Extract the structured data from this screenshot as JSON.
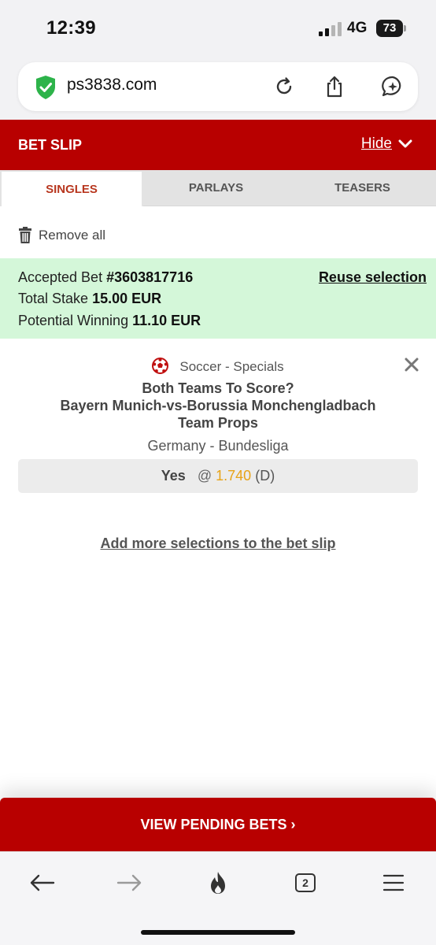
{
  "status_bar": {
    "time": "12:39",
    "network": "4G",
    "battery": "73"
  },
  "browser": {
    "url": "ps3838.com",
    "icons": [
      "shield-check-icon",
      "reload-icon",
      "share-icon",
      "chat-icon"
    ]
  },
  "bet_slip": {
    "title": "BET SLIP",
    "hide_label": "Hide",
    "tabs": [
      {
        "label": "SINGLES",
        "active": true
      },
      {
        "label": "PARLAYS",
        "active": false
      },
      {
        "label": "TEASERS",
        "active": false
      }
    ],
    "remove_all": "Remove all"
  },
  "accepted": {
    "bet_label": "Accepted Bet",
    "bet_number": "#3603817716",
    "stake_label": "Total Stake",
    "stake_value": "15.00 EUR",
    "winning_label": "Potential Winning",
    "winning_value": "11.10 EUR",
    "reuse_label": "Reuse selection",
    "bg_color": "#d4f7d9"
  },
  "selection": {
    "sport": "Soccer - Specials",
    "market_line1": "Both Teams To Score?",
    "market_line2": "Bayern Munich-vs-Borussia Monchengladbach",
    "market_line3": "Team Props",
    "league": "Germany - Bundesliga",
    "pick": "Yes",
    "at": "@",
    "price": "1.740",
    "odds_format": "(D)",
    "price_color": "#e8a317"
  },
  "add_more": "Add more selections to the bet slip",
  "pending_button": "VIEW PENDING BETS ›",
  "toolbar": {
    "tab_count": "2"
  },
  "colors": {
    "brand_red": "#b80000",
    "active_tab_text": "#b8371f"
  }
}
